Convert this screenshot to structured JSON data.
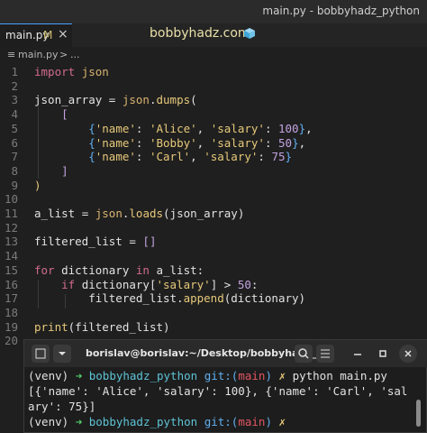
{
  "window": {
    "title": "main.py - bobbyhadz_python"
  },
  "tab": {
    "filename": "main.py",
    "modified": "M",
    "close": "×"
  },
  "brand": {
    "text": "bobbyhadz.com"
  },
  "breadcrumb": {
    "file": "main.py",
    "sep": ">",
    "more": "..."
  },
  "code_lines": [
    {
      "n": "1",
      "parts": [
        [
          "k",
          "import"
        ],
        [
          "p",
          " "
        ],
        [
          "m",
          "json"
        ]
      ]
    },
    {
      "n": "2",
      "parts": []
    },
    {
      "n": "3",
      "parts": [
        [
          "p",
          "json_array "
        ],
        [
          "p",
          "= "
        ],
        [
          "m",
          "json"
        ],
        [
          "p",
          "."
        ],
        [
          "f",
          "dumps"
        ],
        [
          "p",
          "("
        ]
      ]
    },
    {
      "n": "4",
      "parts": [
        [
          "p",
          "    "
        ],
        [
          "n",
          "["
        ]
      ]
    },
    {
      "n": "5",
      "parts": [
        [
          "p",
          "        "
        ],
        [
          "b",
          "{"
        ],
        [
          "s",
          "'name'"
        ],
        [
          "p",
          ": "
        ],
        [
          "s",
          "'Alice'"
        ],
        [
          "p",
          ", "
        ],
        [
          "s",
          "'salary'"
        ],
        [
          "p",
          ": "
        ],
        [
          "n",
          "100"
        ],
        [
          "b",
          "}"
        ],
        [
          "p",
          ","
        ]
      ]
    },
    {
      "n": "6",
      "parts": [
        [
          "p",
          "        "
        ],
        [
          "b",
          "{"
        ],
        [
          "s",
          "'name'"
        ],
        [
          "p",
          ": "
        ],
        [
          "s",
          "'Bobby'"
        ],
        [
          "p",
          ", "
        ],
        [
          "s",
          "'salary'"
        ],
        [
          "p",
          ": "
        ],
        [
          "n",
          "50"
        ],
        [
          "b",
          "}"
        ],
        [
          "p",
          ","
        ]
      ]
    },
    {
      "n": "7",
      "parts": [
        [
          "p",
          "        "
        ],
        [
          "b",
          "{"
        ],
        [
          "s",
          "'name'"
        ],
        [
          "p",
          ": "
        ],
        [
          "s",
          "'Carl'"
        ],
        [
          "p",
          ", "
        ],
        [
          "s",
          "'salary'"
        ],
        [
          "p",
          ": "
        ],
        [
          "n",
          "75"
        ],
        [
          "b",
          "}"
        ]
      ]
    },
    {
      "n": "8",
      "parts": [
        [
          "p",
          "    "
        ],
        [
          "n",
          "]"
        ]
      ]
    },
    {
      "n": "9",
      "parts": [
        [
          "f",
          ")"
        ]
      ]
    },
    {
      "n": "10",
      "parts": []
    },
    {
      "n": "11",
      "parts": [
        [
          "p",
          "a_list "
        ],
        [
          "p",
          "= "
        ],
        [
          "m",
          "json"
        ],
        [
          "p",
          "."
        ],
        [
          "f",
          "loads"
        ],
        [
          "p",
          "(json_array)"
        ]
      ]
    },
    {
      "n": "12",
      "parts": []
    },
    {
      "n": "13",
      "parts": [
        [
          "p",
          "filtered_list "
        ],
        [
          "p",
          "= "
        ],
        [
          "n",
          "[]"
        ]
      ]
    },
    {
      "n": "14",
      "parts": []
    },
    {
      "n": "15",
      "parts": [
        [
          "k",
          "for"
        ],
        [
          "p",
          " dictionary "
        ],
        [
          "k",
          "in"
        ],
        [
          "p",
          " a_list:"
        ]
      ]
    },
    {
      "n": "16",
      "parts": [
        [
          "p",
          "    "
        ],
        [
          "k",
          "if"
        ],
        [
          "p",
          " dictionary["
        ],
        [
          "s",
          "'salary'"
        ],
        [
          "p",
          "] > "
        ],
        [
          "n",
          "50"
        ],
        [
          "p",
          ":"
        ]
      ]
    },
    {
      "n": "17",
      "parts": [
        [
          "p",
          "        filtered_list."
        ],
        [
          "f",
          "append"
        ],
        [
          "p",
          "(dictionary)"
        ]
      ]
    },
    {
      "n": "18",
      "parts": []
    },
    {
      "n": "19",
      "parts": [
        [
          "f",
          "print"
        ],
        [
          "p",
          "(filtered_list)"
        ]
      ]
    },
    {
      "n": "20",
      "parts": []
    }
  ],
  "terminal": {
    "title": "borislav@borislav:~/Desktop/bobbyhadz_...",
    "lines": [
      [
        [
          "p",
          "(venv) "
        ],
        [
          "g",
          "➜ "
        ],
        [
          "c",
          "bobbyhadz_python "
        ],
        [
          "b",
          "git:("
        ],
        [
          "r",
          "main"
        ],
        [
          "b",
          ") "
        ],
        [
          "y",
          "✗ "
        ],
        [
          "p",
          "python main.py"
        ]
      ],
      [
        [
          "p",
          "[{'name': 'Alice', 'salary': 100}, {'name': 'Carl', 'sal"
        ]
      ],
      [
        [
          "p",
          "ary': 75}]"
        ]
      ],
      [
        [
          "p",
          "(venv) "
        ],
        [
          "g",
          "➜ "
        ],
        [
          "c",
          "bobbyhadz_python "
        ],
        [
          "b",
          "git:("
        ],
        [
          "r",
          "main"
        ],
        [
          "b",
          ") "
        ],
        [
          "y",
          "✗ "
        ]
      ]
    ]
  }
}
